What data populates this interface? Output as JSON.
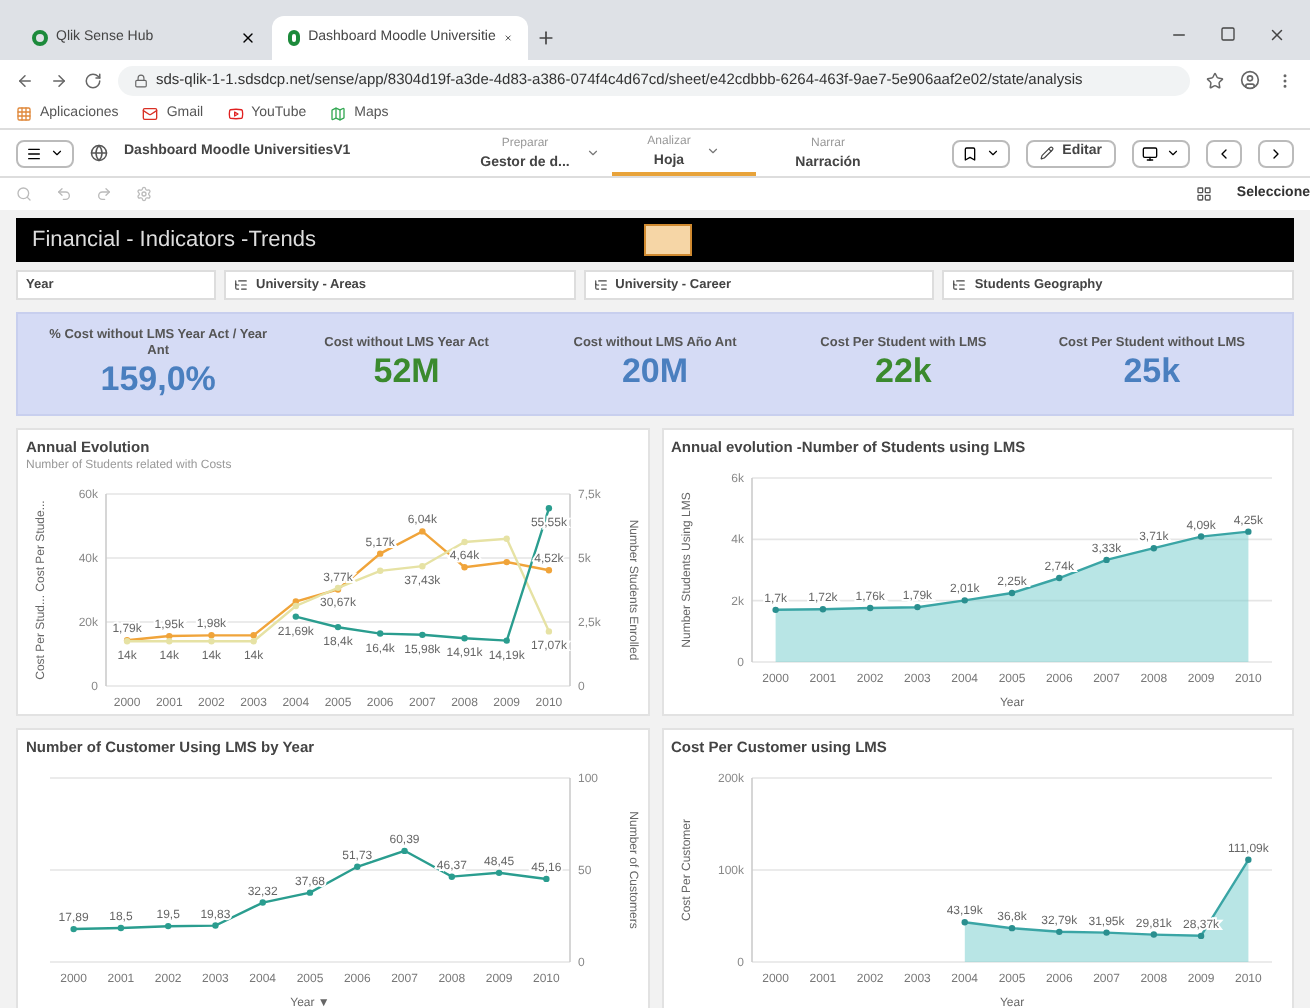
{
  "browser": {
    "tabs": [
      {
        "title": "Qlik Sense Hub",
        "selected": false
      },
      {
        "title": "Dashboard Moodle Universitie",
        "selected": true
      }
    ],
    "url": "sds-qlik-1-1.sdsdcp.net/sense/app/8304d19f-a3de-4d83-a386-074f4c4d67cd/sheet/e42cdbbb-6264-463f-9ae7-5e906aaf2e02/state/analysis",
    "bookmarks": [
      "Aplicaciones",
      "Gmail",
      "YouTube",
      "Maps"
    ]
  },
  "toolbar": {
    "app_name": "Dashboard Moodle UniversitiesV1",
    "nav": [
      {
        "caption": "Preparar",
        "label": "Gestor de d...",
        "selected": false,
        "dropdown": true
      },
      {
        "caption": "Analizar",
        "label": "Hoja",
        "selected": true,
        "dropdown": true
      },
      {
        "caption": "Narrar",
        "label": "Narración",
        "selected": false,
        "dropdown": false
      }
    ],
    "edit_button": "Editar",
    "selections": "Seleccione"
  },
  "sheet": {
    "title": "Financial - Indicators -Trends"
  },
  "filters": [
    {
      "label": "Year",
      "kind": "field"
    },
    {
      "label": "University - Areas",
      "kind": "drilldown"
    },
    {
      "label": "University - Career",
      "kind": "drilldown"
    },
    {
      "label": "Students Geography",
      "kind": "drilldown"
    }
  ],
  "kpis": [
    {
      "label": "% Cost without LMS Year Act / Year Ant",
      "value": "159,0%",
      "color": "#4a7fbf"
    },
    {
      "label": "Cost without LMS Year Act",
      "value": "52M",
      "color": "#3b8a2e"
    },
    {
      "label": "Cost without LMS Año Ant",
      "value": "20M",
      "color": "#4a7fbf"
    },
    {
      "label": "Cost Per Student with LMS",
      "value": "22k",
      "color": "#3b8a2e"
    },
    {
      "label": "Cost Per Student without LMS",
      "value": "25k",
      "color": "#4a7fbf"
    }
  ],
  "charts": [
    {
      "title": "Annual Evolution",
      "subtitle": "Number of Students related with Costs",
      "chart_data": {
        "type": "line",
        "ylabel": "Cost Per Stud... Cost Per Stude...",
        "y2label": "Number Students Enrolled",
        "x": [
          "2000",
          "2001",
          "2002",
          "2003",
          "2004",
          "2005",
          "2006",
          "2007",
          "2008",
          "2009",
          "2010"
        ],
        "ylim": [
          0,
          60000
        ],
        "yticks": [
          {
            "value": 0,
            "label": "0"
          },
          {
            "value": 20000,
            "label": "20k"
          },
          {
            "value": 40000,
            "label": "40k"
          },
          {
            "value": 60000,
            "label": "60k"
          }
        ],
        "y2lim": [
          0,
          7500
        ],
        "y2ticks": [
          {
            "value": 0,
            "label": "0"
          },
          {
            "value": 2500,
            "label": "2,5k"
          },
          {
            "value": 5000,
            "label": "5k"
          },
          {
            "value": 7500,
            "label": "7,5k"
          }
        ],
        "series": [
          {
            "color": "#f0a43a",
            "axis": "y2",
            "marker": "circle",
            "values": [
              1790,
              1950,
              1980,
              1980,
              3300,
              3770,
              5170,
              6040,
              4640,
              4840,
              4520
            ],
            "value_labels": [
              "1,79k",
              "1,95k",
              "1,98k",
              null,
              null,
              "3,77k",
              "5,17k",
              "6,04k",
              "4,64k",
              null,
              "4,52k"
            ]
          },
          {
            "color": "#e6e2a4",
            "marker": "circle",
            "values": [
              14000,
              14000,
              14000,
              14000,
              25000,
              30670,
              36000,
              37430,
              45000,
              46000,
              17070
            ],
            "value_labels": [
              "14k",
              "14k",
              "14k",
              "14k",
              null,
              "30,67k",
              null,
              "37,43k",
              null,
              null,
              "17,07k"
            ]
          },
          {
            "color": "#2a9d8f",
            "marker": "circle",
            "values": [
              null,
              null,
              null,
              null,
              21690,
              18400,
              16400,
              15980,
              14910,
              14190,
              55550
            ],
            "value_labels": [
              null,
              null,
              null,
              null,
              "21,69k",
              "18,4k",
              "16,4k",
              "15,98k",
              "14,91k",
              "14,19k",
              "55,55k"
            ]
          }
        ]
      }
    },
    {
      "title": "Annual evolution -Number of Students using LMS",
      "chart_data": {
        "type": "area",
        "ylabel": "Number Students Using LMS",
        "xlabel": "Year",
        "x": [
          "2000",
          "2001",
          "2002",
          "2003",
          "2004",
          "2005",
          "2006",
          "2007",
          "2008",
          "2009",
          "2010"
        ],
        "ylim": [
          0,
          6000
        ],
        "yticks": [
          {
            "value": 0,
            "label": "0"
          },
          {
            "value": 2000,
            "label": "2k"
          },
          {
            "value": 4000,
            "label": "4k"
          },
          {
            "value": 6000,
            "label": "6k"
          }
        ],
        "series": [
          {
            "color": "#7ecfcf",
            "marker": "circle",
            "values": [
              1700,
              1720,
              1760,
              1790,
              2010,
              2250,
              2740,
              3330,
              3710,
              4090,
              4250
            ],
            "value_labels": [
              "1,7k",
              "1,72k",
              "1,76k",
              "1,79k",
              "2,01k",
              "2,25k",
              "2,74k",
              "3,33k",
              "3,71k",
              "4,09k",
              "4,25k"
            ]
          }
        ]
      }
    },
    {
      "title": "Number of Customer Using LMS by Year",
      "chart_data": {
        "type": "line",
        "y2label": "Number of Customers",
        "xlabel": "Year ▼",
        "x": [
          "2000",
          "2001",
          "2002",
          "2003",
          "2004",
          "2005",
          "2006",
          "2007",
          "2008",
          "2009",
          "2010"
        ],
        "y2lim": [
          0,
          100
        ],
        "y2ticks": [
          0,
          50,
          100
        ],
        "series": [
          {
            "color": "#2a9d8f",
            "axis": "y2",
            "marker": "circle",
            "values": [
              17.89,
              18.5,
              19.5,
              19.83,
              32.32,
              37.68,
              51.73,
              60.39,
              46.37,
              48.45,
              45.16
            ],
            "value_labels": [
              "17,89",
              "18,5",
              "19,5",
              "19,83",
              "32,32",
              "37,68",
              "51,73",
              "60,39",
              "46,37",
              "48,45",
              "45,16"
            ]
          }
        ]
      }
    },
    {
      "title": "Cost Per Customer using LMS",
      "chart_data": {
        "type": "area",
        "ylabel": "Cost Per Customer",
        "xlabel": "Year",
        "x": [
          "2000",
          "2001",
          "2002",
          "2003",
          "2004",
          "2005",
          "2006",
          "2007",
          "2008",
          "2009",
          "2010"
        ],
        "ylim": [
          0,
          200000
        ],
        "yticks": [
          {
            "value": 0,
            "label": "0"
          },
          {
            "value": 100000,
            "label": "100k"
          },
          {
            "value": 200000,
            "label": "200k"
          }
        ],
        "series": [
          {
            "color": "#7ecfcf",
            "marker": "circle",
            "values": [
              null,
              null,
              null,
              null,
              43190,
              36800,
              32790,
              31950,
              29810,
              28370,
              111090
            ],
            "value_labels": [
              null,
              null,
              null,
              null,
              "43,19k",
              "36,8k",
              "32,79k",
              "31,95k",
              "29,81k",
              "28,37k",
              "111,09k"
            ]
          }
        ]
      }
    }
  ]
}
